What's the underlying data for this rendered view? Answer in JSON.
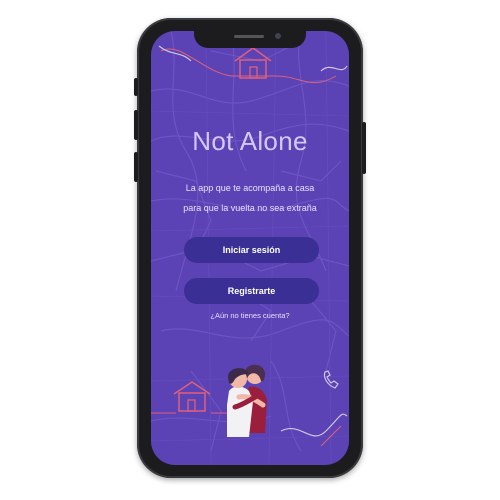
{
  "app": {
    "name": "Not Alone",
    "tagline_line1": "La app que te acompaña a casa",
    "tagline_line2": "para que la vuelta no sea extraña"
  },
  "actions": {
    "login_label": "Iniciar sesión",
    "register_label": "Registrarte",
    "no_account_link": "¿Aún no tienes cuenta?"
  },
  "illustration": {
    "description_icons": [
      "house-icon",
      "two-people-hugging-illustration",
      "phone-handset-icon"
    ]
  },
  "colors": {
    "screen_bg": "#5b42b5",
    "button_bg": "#3a2f94",
    "title": "#d5c8ff",
    "line_accent": "#e0607a"
  }
}
